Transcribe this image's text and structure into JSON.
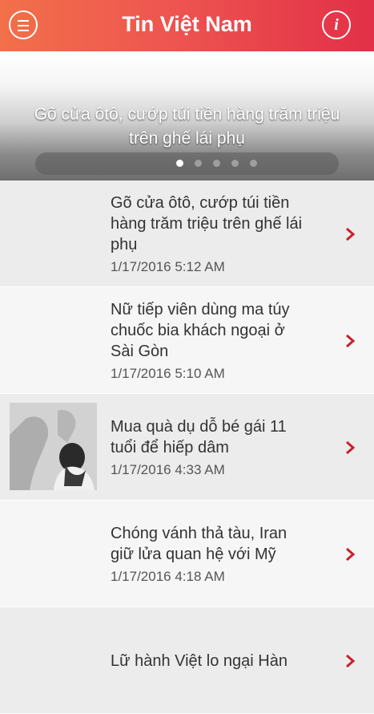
{
  "header": {
    "title": "Tin Việt Nam",
    "menu_icon": "hamburger-menu-icon",
    "info_icon": "info-icon",
    "info_glyph": "i"
  },
  "banner": {
    "headline_line1": "Gõ cửa ôtô, cướp túi tiền hàng trăm triệu",
    "headline_line2": "trên ghế lái phụ",
    "pages": 5,
    "active_page": 1
  },
  "articles": [
    {
      "title_lines": [
        "Gõ cửa ôtô, cướp túi tiền",
        "hàng trăm triệu trên ghế lái",
        "phụ"
      ],
      "date": "1/17/2016 5:12 AM",
      "has_thumbnail": false
    },
    {
      "title_lines": [
        "Nữ tiếp viên dùng ma túy",
        "chuốc bia khách ngoại ở",
        "Sài Gòn"
      ],
      "date": "1/17/2016 5:10 AM",
      "has_thumbnail": false
    },
    {
      "title_lines": [
        "Mua quà dụ dỗ bé gái 11",
        "tuổi để hiếp dâm"
      ],
      "date": "1/17/2016 4:33 AM",
      "has_thumbnail": true
    },
    {
      "title_lines": [
        "Chóng vánh thả tàu, Iran",
        "giữ lửa quan hệ với Mỹ"
      ],
      "date": "1/17/2016 4:18 AM",
      "has_thumbnail": false
    },
    {
      "title_lines": [
        "Lữ hành Việt lo ngại Hàn"
      ],
      "date": "",
      "has_thumbnail": false
    }
  ],
  "colors": {
    "header_left": "#f2704a",
    "header_right": "#e23048",
    "chevron": "#c8202e"
  }
}
